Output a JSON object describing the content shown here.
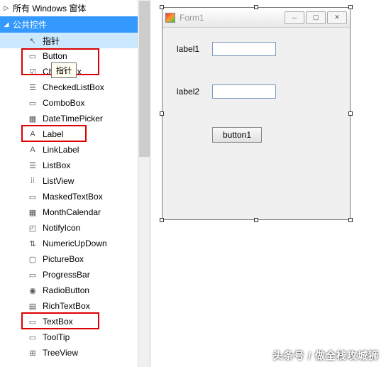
{
  "toolbox": {
    "group_collapsed": "所有 Windows 窗体",
    "group_expanded": "公共控件",
    "tooltip": "指针",
    "items": [
      {
        "label": "指针",
        "icon": "↖"
      },
      {
        "label": "Button",
        "icon": "▭"
      },
      {
        "label": "CheckBox",
        "icon": "☑"
      },
      {
        "label": "CheckedListBox",
        "icon": "☰"
      },
      {
        "label": "ComboBox",
        "icon": "▭"
      },
      {
        "label": "DateTimePicker",
        "icon": "▦"
      },
      {
        "label": "Label",
        "icon": "A"
      },
      {
        "label": "LinkLabel",
        "icon": "A"
      },
      {
        "label": "ListBox",
        "icon": "☰"
      },
      {
        "label": "ListView",
        "icon": "⁞⁞"
      },
      {
        "label": "MaskedTextBox",
        "icon": "▭"
      },
      {
        "label": "MonthCalendar",
        "icon": "▦"
      },
      {
        "label": "NotifyIcon",
        "icon": "◰"
      },
      {
        "label": "NumericUpDown",
        "icon": "⇅"
      },
      {
        "label": "PictureBox",
        "icon": "▢"
      },
      {
        "label": "ProgressBar",
        "icon": "▭"
      },
      {
        "label": "RadioButton",
        "icon": "◉"
      },
      {
        "label": "RichTextBox",
        "icon": "▤"
      },
      {
        "label": "TextBox",
        "icon": "▭"
      },
      {
        "label": "ToolTip",
        "icon": "▭"
      },
      {
        "label": "TreeView",
        "icon": "⊞"
      }
    ]
  },
  "form": {
    "title": "Form1",
    "label1": "label1",
    "label2": "label2",
    "button1": "button1"
  },
  "watermark": "头条号 / 做全栈攻城狮"
}
